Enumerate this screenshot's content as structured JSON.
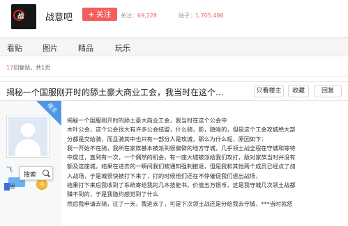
{
  "forum": {
    "logo_text": "战",
    "name": "战意吧",
    "follow_plus": "+",
    "follow_label": "关注",
    "followers_label": "关注：",
    "followers_value": "69,228",
    "posts_label": "贴子：",
    "posts_value": "1,705,486"
  },
  "nav": {
    "items": [
      {
        "label": "看贴"
      },
      {
        "label": "图片"
      },
      {
        "label": "精品"
      },
      {
        "label": "玩乐"
      }
    ]
  },
  "replies": {
    "count": "17",
    "text": "回复贴，共1页"
  },
  "post": {
    "title": "揭秘一个国服刚开时的舔土豪大商业工会，我当时在这个...",
    "buttons": {
      "only_author": "只看楼主",
      "collect": "收藏",
      "reply": "回复"
    },
    "badge": "楼主",
    "user_name": "飞",
    "level": "4",
    "search_popup": "搜索",
    "selected_text": "思",
    "lines": [
      "揭秘一个国服刚开时的舔土豪大商业工会，我当时在这个公会中",
      "木叶公会，这个公会很大有许多公会结盟，什么骑，影，隐啥的，但是这个工会攻城绝大部",
      "分都是交给骑，而且骑其中也只有一部分人是攻城，那么为什么呢，原因如下：",
      "我一开始不在骑，我所在家族基本被派到很偏僻的地方守城，几乎领土战全程在守城和等待",
      "中度过，直到有一次，一个偶然的机会，有一座大城被派给我们攻打，敌对家族当时并没有",
      "额及这座城，结果在进去的一瞬间我们被通知强制撤退，但是我和其他两个成员已经点了加",
      "入战场，于是城很快被打下来了，打的时候他们还在不停催促我们退出战场，",
      "结果打下来后我收到了系统寄给我的几本技能书，价值五万银币，这是我守城几次领土战都",
      "赚不到的，于是我隐约感觉到了什么",
      "然后我申请去骑，过了一天，我进去了，可是下次领土战还是分给我去守城，***当时就怒"
    ]
  }
}
